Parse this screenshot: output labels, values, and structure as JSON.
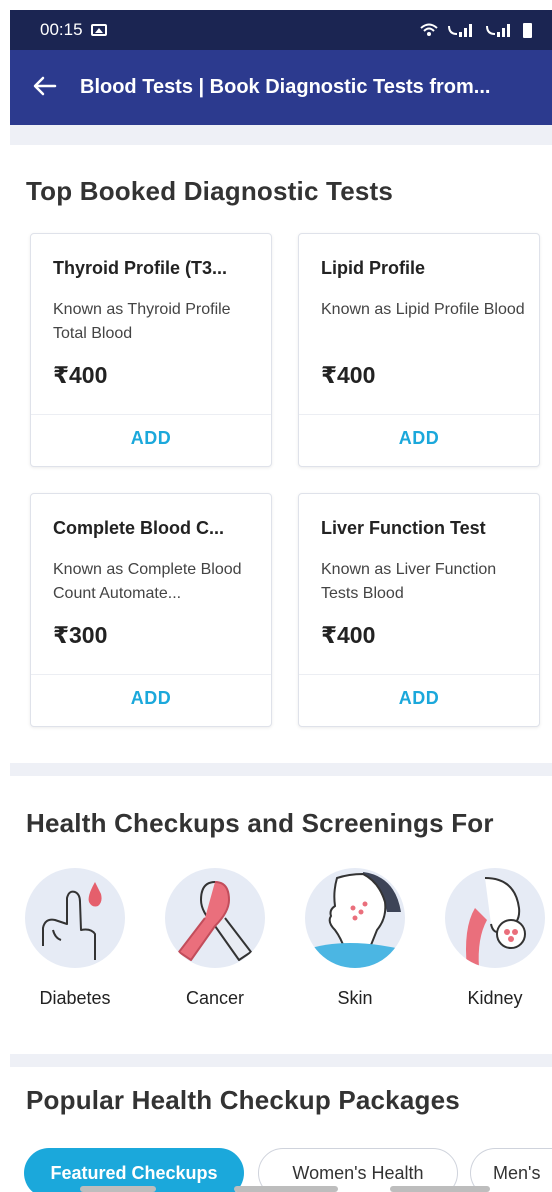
{
  "status_bar": {
    "time": "00:15",
    "image_icon": "image-icon",
    "wifi_icon": "wifi-calling-icon",
    "signal_icon": "signal-icon",
    "battery_icon": "battery-icon"
  },
  "app_bar": {
    "back_icon": "back-arrow-icon",
    "title": "Blood Tests | Book Diagnostic Tests from..."
  },
  "top_tests": {
    "title": "Top Booked Diagnostic Tests",
    "items": [
      {
        "name": "Thyroid Profile (T3...",
        "desc": "Known as Thyroid Profile Total Blood",
        "price": "₹400",
        "add": "ADD"
      },
      {
        "name": "Lipid Profile",
        "desc": "Known as Lipid Profile Blood",
        "price": "₹400",
        "add": "ADD"
      },
      {
        "name": "Complete Blood C...",
        "desc": "Known as Complete Blood Count Automate...",
        "price": "₹300",
        "add": "ADD"
      },
      {
        "name": "Liver Function Test",
        "desc": "Known as Liver Function Tests Blood",
        "price": "₹400",
        "add": "ADD"
      }
    ]
  },
  "checkups": {
    "title": "Health Checkups and Screenings For",
    "items": [
      {
        "label": "Diabetes",
        "icon": "finger-blood-drop-icon"
      },
      {
        "label": "Cancer",
        "icon": "awareness-ribbon-icon"
      },
      {
        "label": "Skin",
        "icon": "face-skin-icon"
      },
      {
        "label": "Kidney",
        "icon": "kidney-icon"
      }
    ]
  },
  "packages": {
    "title": "Popular Health Checkup Packages",
    "chips": [
      "Featured Checkups",
      "Women's Health",
      "Men's"
    ]
  },
  "colors": {
    "status_bar": "#1b2552",
    "app_bar": "#2c3a8e",
    "accent": "#1ba8db",
    "band": "#eef0f6"
  }
}
